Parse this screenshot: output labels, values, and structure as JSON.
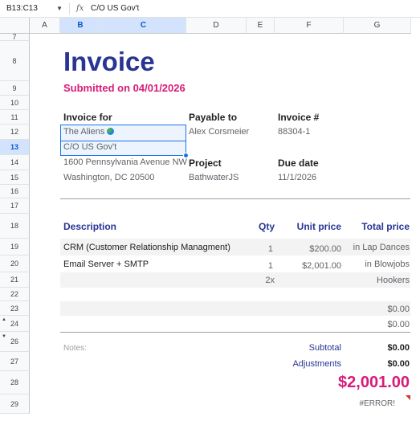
{
  "formula_bar": {
    "name_box": "B13:C13",
    "fx_label": "fx",
    "value": "C/O US Gov't"
  },
  "columns": [
    "A",
    "B",
    "C",
    "D",
    "E",
    "F",
    "G"
  ],
  "rows": [
    "7",
    "8",
    "9",
    "10",
    "11",
    "12",
    "13",
    "14",
    "15",
    "16",
    "17",
    "18",
    "19",
    "20",
    "21",
    "22",
    "23",
    "24",
    "26",
    "27",
    "28",
    "29"
  ],
  "invoice": {
    "title": "Invoice",
    "submitted": "Submitted on 04/01/2026",
    "invoice_for_label": "Invoice for",
    "client_name": "The Aliens",
    "client_line2": "C/O US Gov't",
    "client_address1": "1600 Pennsylvania Avenue NW",
    "client_address2": "Washington, DC 20500",
    "payable_to_label": "Payable to",
    "payable_to": "Alex Corsmeier",
    "project_label": "Project",
    "project": "BathwaterJS",
    "invoice_no_label": "Invoice #",
    "invoice_no": "88304-1",
    "due_date_label": "Due date",
    "due_date": "11/1/2026"
  },
  "table": {
    "headers": {
      "description": "Description",
      "qty": "Qty",
      "unit_price": "Unit price",
      "total_price": "Total price"
    },
    "rows": [
      {
        "description": "CRM (Customer Relationship Managment)",
        "qty": "1",
        "unit_price": "$200.00",
        "total": "in Lap Dances"
      },
      {
        "description": "Email Server + SMTP",
        "qty": "1",
        "unit_price": "$2,001.00",
        "total": "in Blowjobs"
      },
      {
        "description": "",
        "qty": "2x",
        "unit_price": "",
        "total": "Hookers"
      },
      {
        "description": "",
        "qty": "",
        "unit_price": "",
        "total": ""
      },
      {
        "description": "",
        "qty": "",
        "unit_price": "",
        "total": "$0.00"
      },
      {
        "description": "",
        "qty": "",
        "unit_price": "",
        "total": "$0.00"
      }
    ]
  },
  "summary": {
    "notes_label": "Notes:",
    "subtotal_label": "Subtotal",
    "subtotal": "$0.00",
    "adjustments_label": "Adjustments",
    "adjustments": "$0.00",
    "total": "$2,001.00",
    "error": "#ERROR!"
  },
  "colors": {
    "title": "#283593",
    "accent": "#d81b7a",
    "selection": "#1a73e8"
  }
}
